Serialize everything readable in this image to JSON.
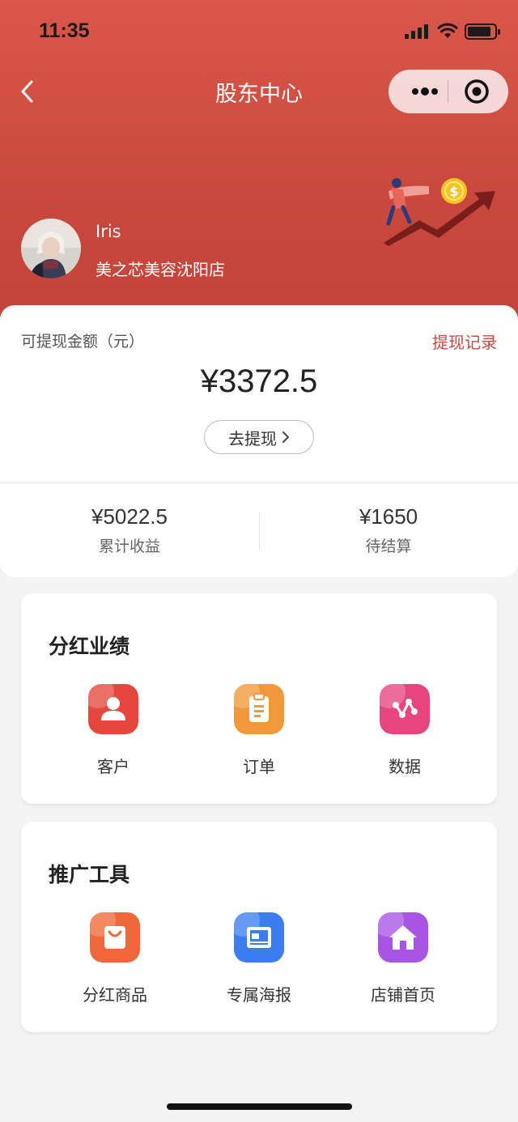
{
  "status_bar": {
    "time": "11:35"
  },
  "nav": {
    "title": "股东中心"
  },
  "user": {
    "name": "Iris",
    "store": "美之芯美容沈阳店"
  },
  "balance": {
    "label": "可提现金额（元）",
    "history_link": "提现记录",
    "amount": "¥3372.5",
    "withdraw_button": "去提现"
  },
  "stats": [
    {
      "value": "¥5022.5",
      "label": "累计收益"
    },
    {
      "value": "¥1650",
      "label": "待结算"
    }
  ],
  "sections": [
    {
      "title": "分红业绩",
      "items": [
        {
          "label": "客户",
          "icon": "user-icon",
          "color": "#e5473d"
        },
        {
          "label": "订单",
          "icon": "clipboard-icon",
          "color": "#f1993a"
        },
        {
          "label": "数据",
          "icon": "graph-icon",
          "color": "#e8457f"
        }
      ]
    },
    {
      "title": "推广工具",
      "items": [
        {
          "label": "分红商品",
          "icon": "shopping-bag-icon",
          "color": "#f0673a"
        },
        {
          "label": "专属海报",
          "icon": "image-icon",
          "color": "#3c7ef0"
        },
        {
          "label": "店铺首页",
          "icon": "home-icon",
          "color": "#a855e6"
        }
      ]
    }
  ],
  "colors": {
    "primary": "#c9483d",
    "header_top": "#d9574a",
    "background": "#f4f4f4"
  }
}
